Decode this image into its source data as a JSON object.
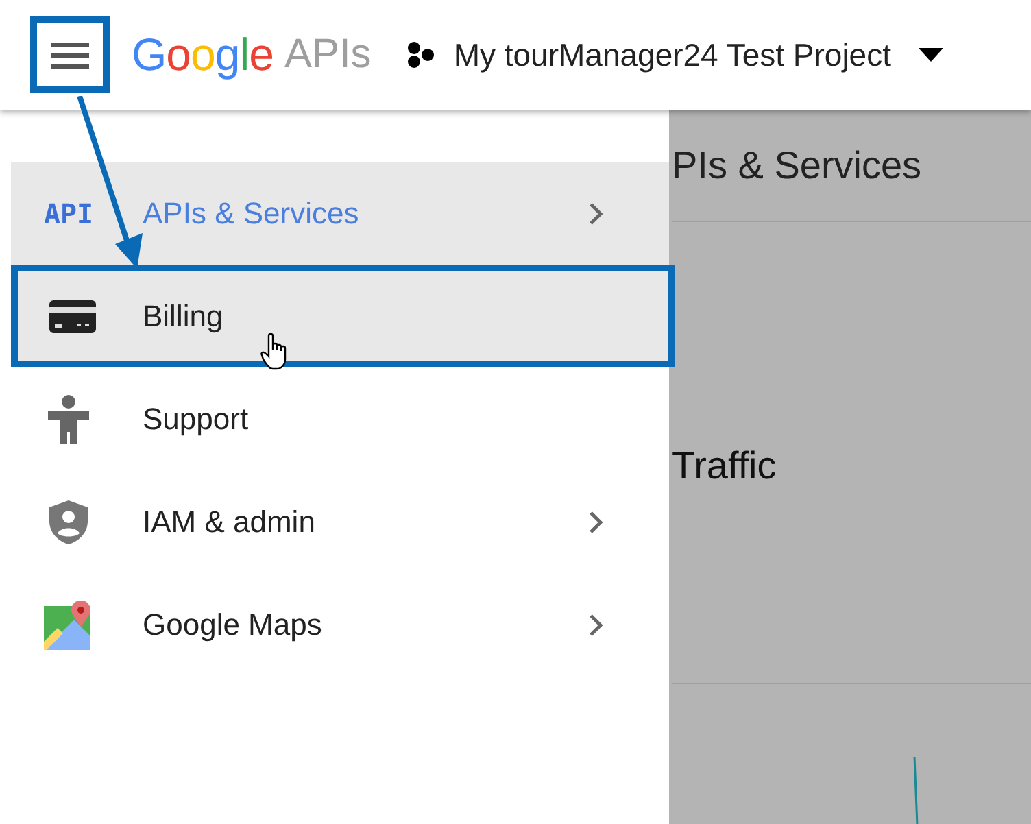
{
  "header": {
    "menu_button": {
      "callout": true
    },
    "logo": {
      "brand": "Google",
      "product": "APIs"
    },
    "project": {
      "name": "My tourManager24 Test Project"
    }
  },
  "menu": [
    {
      "kind": "api",
      "icon_label": "API",
      "label": "APIs & Services",
      "submenu": true,
      "selected": true,
      "hovered": false,
      "callout": false
    },
    {
      "kind": "card",
      "label": "Billing",
      "submenu": false,
      "selected": false,
      "hovered": true,
      "callout": true
    },
    {
      "kind": "person",
      "label": "Support",
      "submenu": false,
      "selected": false,
      "hovered": false,
      "callout": false
    },
    {
      "kind": "shield",
      "label": "IAM & admin",
      "submenu": true,
      "selected": false,
      "hovered": false,
      "callout": false
    },
    {
      "kind": "map",
      "label": "Google Maps",
      "submenu": true,
      "selected": false,
      "hovered": false,
      "callout": false
    }
  ],
  "page": {
    "title": "PIs & Services",
    "section": "Traffic"
  }
}
